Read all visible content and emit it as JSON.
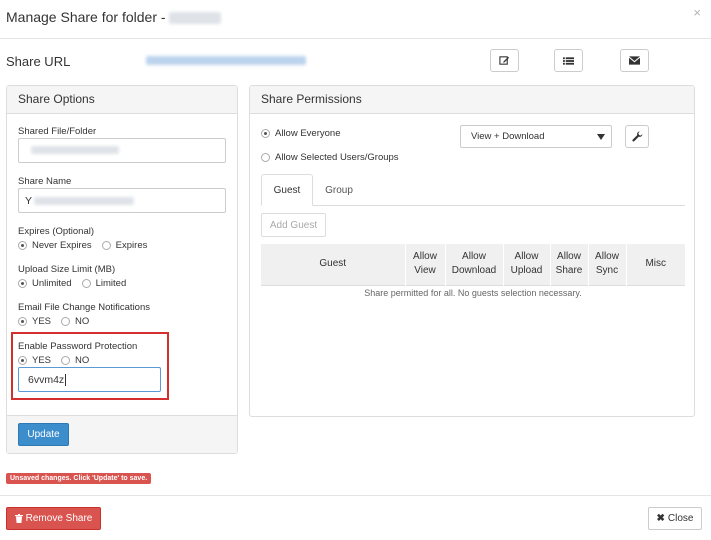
{
  "header": {
    "title": "Manage Share for folder - ",
    "close_glyph": "×"
  },
  "share_url": {
    "label": "Share URL"
  },
  "share_options": {
    "heading": "Share Options",
    "shared_file_label": "Shared File/Folder",
    "share_name_label": "Share Name",
    "share_name_prefix": "Y",
    "expires_label": "Expires (Optional)",
    "expires_never": "Never Expires",
    "expires_yes": "Expires",
    "upload_limit_label": "Upload Size Limit (MB)",
    "upload_unlimited": "Unlimited",
    "upload_limited": "Limited",
    "email_notif_label": "Email File Change Notifications",
    "email_yes": "YES",
    "email_no": "NO",
    "password_label": "Enable Password Protection",
    "password_yes": "YES",
    "password_no": "NO",
    "password_value": "6vvm4z",
    "update_label": "Update"
  },
  "share_permissions": {
    "heading": "Share Permissions",
    "allow_everyone": "Allow Everyone",
    "allow_selected": "Allow Selected Users/Groups",
    "permission_selected": "View + Download",
    "tabs": [
      {
        "label": "Guest"
      },
      {
        "label": "Group"
      }
    ],
    "add_guest_label": "Add Guest",
    "columns": [
      {
        "line1": "Guest",
        "line2": ""
      },
      {
        "line1": "Allow",
        "line2": "View"
      },
      {
        "line1": "Allow",
        "line2": "Download"
      },
      {
        "line1": "Allow",
        "line2": "Upload"
      },
      {
        "line1": "Allow",
        "line2": "Share"
      },
      {
        "line1": "Allow",
        "line2": "Sync"
      },
      {
        "line1": "Misc",
        "line2": ""
      }
    ],
    "empty_message": "Share permitted for all. No guests selection necessary."
  },
  "footer": {
    "unsaved_badge": "Unsaved changes. Click 'Update' to save.",
    "remove_label": "Remove Share",
    "close_label": "Close"
  },
  "colors": {
    "primary": "#3c8dcc",
    "danger": "#d9534f",
    "highlight": "#d32f2f"
  }
}
